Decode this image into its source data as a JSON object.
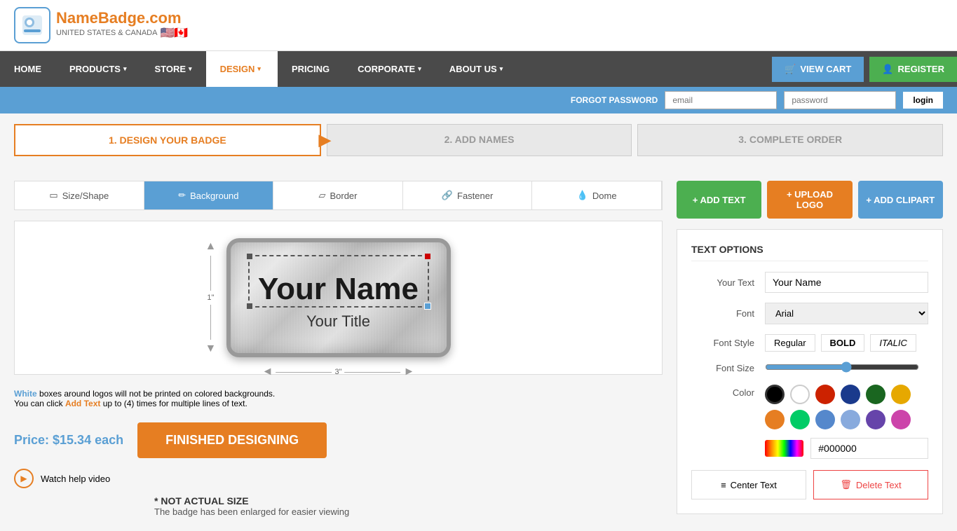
{
  "site": {
    "logo_name": "NameBadge",
    "logo_domain": ".com",
    "logo_sub": "UNITED STATES & CANADA"
  },
  "nav": {
    "items": [
      {
        "label": "HOME",
        "active": false
      },
      {
        "label": "PRODUCTS ▾",
        "active": false
      },
      {
        "label": "STORE ▾",
        "active": false
      },
      {
        "label": "DESIGN ▾",
        "active": true
      },
      {
        "label": "PRICING",
        "active": false
      },
      {
        "label": "CORPORATE ▾",
        "active": false
      },
      {
        "label": "ABOUT US ▾",
        "active": false
      }
    ],
    "cart_label": "VIEW CART",
    "register_label": "REGISTER"
  },
  "login_bar": {
    "label": "FORGOT PASSWORD",
    "email_placeholder": "email",
    "password_placeholder": "password",
    "button_label": "login"
  },
  "steps": [
    {
      "number": "1.",
      "label": "DESIGN YOUR BADGE",
      "active": true
    },
    {
      "number": "2.",
      "label": "ADD NAMES",
      "active": false
    },
    {
      "number": "3.",
      "label": "COMPLETE ORDER",
      "active": false
    }
  ],
  "tabs": [
    {
      "label": "Size/Shape",
      "active": false
    },
    {
      "label": "Background",
      "active": true
    },
    {
      "label": "Border",
      "active": false
    },
    {
      "label": "Fastener",
      "active": false
    },
    {
      "label": "Dome",
      "active": false
    }
  ],
  "badge": {
    "text1": "Your Name",
    "text2": "Your Title"
  },
  "rulers": {
    "height": "1\"",
    "width": "3\""
  },
  "notes": {
    "line1_prefix": "",
    "line1_white": "White",
    "line1_suffix": " boxes around logos will not be printed on colored backgrounds.",
    "line2_prefix": "You can click ",
    "line2_link": "Add Text",
    "line2_suffix": " up to (4) times for multiple lines of text."
  },
  "price": {
    "label": "Price: $15.34 each"
  },
  "buttons": {
    "finished": "FINISHED DESIGNING",
    "watch_video": "Watch help video",
    "not_actual": "* NOT ACTUAL SIZE",
    "not_actual_sub": "The badge has been enlarged for easier viewing"
  },
  "action_buttons": {
    "add_text": "+ Add Text",
    "upload_logo": "+ Upload Logo",
    "add_clipart": "+ Add Clipart"
  },
  "text_options": {
    "title": "TEXT OPTIONS",
    "your_text_label": "Your Text",
    "your_text_value": "Your Name",
    "font_label": "Font",
    "font_value": "Arial",
    "font_style_label": "Font Style",
    "font_style_regular": "Regular",
    "font_style_bold": "BOLD",
    "font_style_italic": "ITALIC",
    "font_size_label": "Font Size",
    "color_label": "Color",
    "color_hex": "#000000",
    "center_text": "Center Text",
    "delete_text": "Delete Text"
  }
}
